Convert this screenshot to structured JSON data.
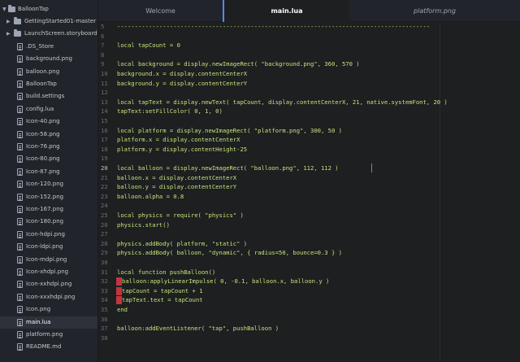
{
  "tree": {
    "root": "BalloonTap",
    "items": [
      {
        "label": "GettingStarted01-master",
        "type": "folder"
      },
      {
        "label": "LaunchScreen.storyboardc",
        "type": "folder"
      },
      {
        "label": ".DS_Store",
        "type": "file"
      },
      {
        "label": "background.png",
        "type": "file"
      },
      {
        "label": "balloon.png",
        "type": "file"
      },
      {
        "label": "BalloonTap",
        "type": "file"
      },
      {
        "label": "build.settings",
        "type": "file"
      },
      {
        "label": "config.lua",
        "type": "file"
      },
      {
        "label": "Icon-40.png",
        "type": "file"
      },
      {
        "label": "Icon-58.png",
        "type": "file"
      },
      {
        "label": "Icon-76.png",
        "type": "file"
      },
      {
        "label": "Icon-80.png",
        "type": "file"
      },
      {
        "label": "Icon-87.png",
        "type": "file"
      },
      {
        "label": "Icon-120.png",
        "type": "file"
      },
      {
        "label": "Icon-152.png",
        "type": "file"
      },
      {
        "label": "Icon-167.png",
        "type": "file"
      },
      {
        "label": "Icon-180.png",
        "type": "file"
      },
      {
        "label": "Icon-hdpi.png",
        "type": "file"
      },
      {
        "label": "Icon-ldpi.png",
        "type": "file"
      },
      {
        "label": "Icon-mdpi.png",
        "type": "file"
      },
      {
        "label": "Icon-xhdpi.png",
        "type": "file"
      },
      {
        "label": "Icon-xxhdpi.png",
        "type": "file"
      },
      {
        "label": "Icon-xxxhdpi.png",
        "type": "file"
      },
      {
        "label": "Icon.png",
        "type": "file"
      },
      {
        "label": "main.lua",
        "type": "file",
        "selected": true
      },
      {
        "label": "platform.png",
        "type": "file"
      },
      {
        "label": "README.md",
        "type": "file"
      }
    ]
  },
  "tabs": [
    {
      "label": "Welcome"
    },
    {
      "label": "main.lua",
      "active": true
    },
    {
      "label": "platform.png",
      "italic": true
    }
  ],
  "editor": {
    "current_line": 20,
    "lines": [
      {
        "n": 5,
        "text": "-----------------------------------------------------------------------------------------"
      },
      {
        "n": 6,
        "text": ""
      },
      {
        "n": 7,
        "text": "local tapCount = 0"
      },
      {
        "n": 8,
        "text": ""
      },
      {
        "n": 9,
        "text": "local background = display.newImageRect( \"background.png\", 360, 570 )"
      },
      {
        "n": 10,
        "text": "background.x = display.contentCenterX"
      },
      {
        "n": 11,
        "text": "background.y = display.contentCenterY"
      },
      {
        "n": 12,
        "text": ""
      },
      {
        "n": 13,
        "text": "local tapText = display.newText( tapCount, display.contentCenterX, 21, native.systemFont, 20 )"
      },
      {
        "n": 14,
        "text": "tapText:setFillColor( 0, 1, 0)"
      },
      {
        "n": 15,
        "text": ""
      },
      {
        "n": 16,
        "text": "local platform = display.newImageRect( \"platform.png\", 300, 50 )"
      },
      {
        "n": 17,
        "text": "platform.x = display.contentCenterX"
      },
      {
        "n": 18,
        "text": "platform.y = display.contentHeight-25"
      },
      {
        "n": 19,
        "text": ""
      },
      {
        "n": 20,
        "text": "local balloon = display.newImageRect( \"balloon.png\", 112, 112 )"
      },
      {
        "n": 21,
        "text": "balloon.x = display.contentCenterX"
      },
      {
        "n": 22,
        "text": "balloon.y = display.contentCenterY"
      },
      {
        "n": 23,
        "text": "balloon.alpha = 0.8"
      },
      {
        "n": 24,
        "text": ""
      },
      {
        "n": 25,
        "text": "local physics = require( \"physics\" )"
      },
      {
        "n": 26,
        "text": "physics.start()"
      },
      {
        "n": 27,
        "text": ""
      },
      {
        "n": 28,
        "text": "physics.addBody( platform, \"static\" )"
      },
      {
        "n": 29,
        "text": "physics.addBody( balloon, \"dynamic\", { radius=50, bounce=0.3 } )"
      },
      {
        "n": 30,
        "text": ""
      },
      {
        "n": 31,
        "text": "local function pushBalloon()"
      },
      {
        "n": 32,
        "text": "balloon:applyLinearImpulse( 0, -0.1, balloon.x, balloon.y )",
        "marker": true
      },
      {
        "n": 33,
        "text": "tapCount = tapCount + 1",
        "marker": true
      },
      {
        "n": 34,
        "text": "tapText.text = tapCount",
        "marker": true
      },
      {
        "n": 35,
        "text": "end"
      },
      {
        "n": 36,
        "text": ""
      },
      {
        "n": 37,
        "text": "balloon:addEventListener( \"tap\", pushBalloon )"
      },
      {
        "n": 38,
        "text": ""
      }
    ]
  },
  "colors": {
    "code_text": "#c5e478",
    "marker": "#c3353d",
    "accent": "#528bff"
  }
}
